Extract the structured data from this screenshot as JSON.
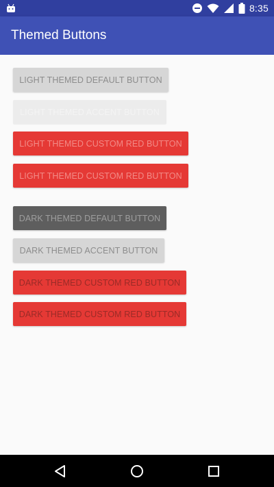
{
  "status_bar": {
    "time": "8:35",
    "icons": [
      "android-icon",
      "do-not-disturb-icon",
      "wifi-icon",
      "signal-icon",
      "battery-icon"
    ]
  },
  "app_bar": {
    "title": "Themed Buttons"
  },
  "buttons": {
    "light_default": "LIGHT THEMED DEFAULT BUTTON",
    "light_accent": "LIGHT THEMED ACCENT BUTTON",
    "light_red_1": "LIGHT THEMED CUSTOM RED BUTTON",
    "light_red_2": "LIGHT THEMED CUSTOM RED BUTTON",
    "dark_default": "DARK THEMED DEFAULT BUTTON",
    "dark_accent": "DARK THEMED ACCENT BUTTON",
    "dark_red_1": "DARK THEMED CUSTOM RED BUTTON",
    "dark_red_2": "DARK THEMED CUSTOM RED BUTTON"
  },
  "nav_bar": {
    "icons": [
      "back-icon",
      "home-icon",
      "recents-icon"
    ]
  },
  "colors": {
    "status_bar": "#303f9f",
    "app_bar": "#3f51b5",
    "background": "#fafafa",
    "red": "#e53935",
    "dark_button": "#5e5e5e",
    "light_button": "#d6d6d6"
  }
}
